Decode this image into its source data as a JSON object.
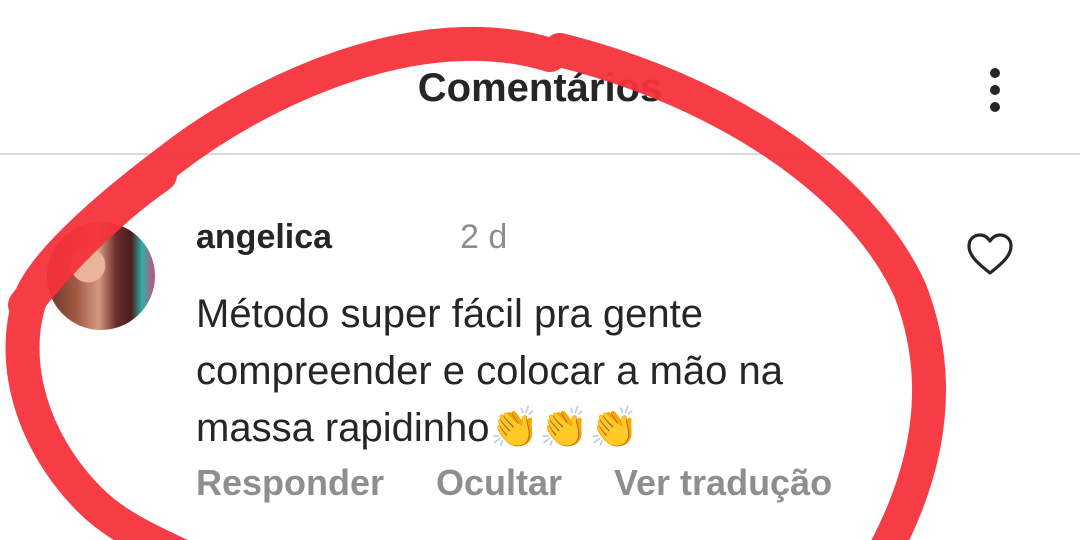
{
  "header": {
    "title": "Comentários"
  },
  "comment": {
    "username": "angelica",
    "timestamp": "2 d",
    "text": "Método super fácil pra gente compreender e colocar a mão na massa rapidinho👏👏👏",
    "actions": {
      "reply": "Responder",
      "hide": "Ocultar",
      "translate": "Ver tradução"
    }
  },
  "icons": [
    "more-vertical-icon",
    "heart-icon"
  ],
  "colors": {
    "annotation": "#f5333b",
    "secondary_text": "#8e8e8e",
    "primary_text": "#262626"
  }
}
